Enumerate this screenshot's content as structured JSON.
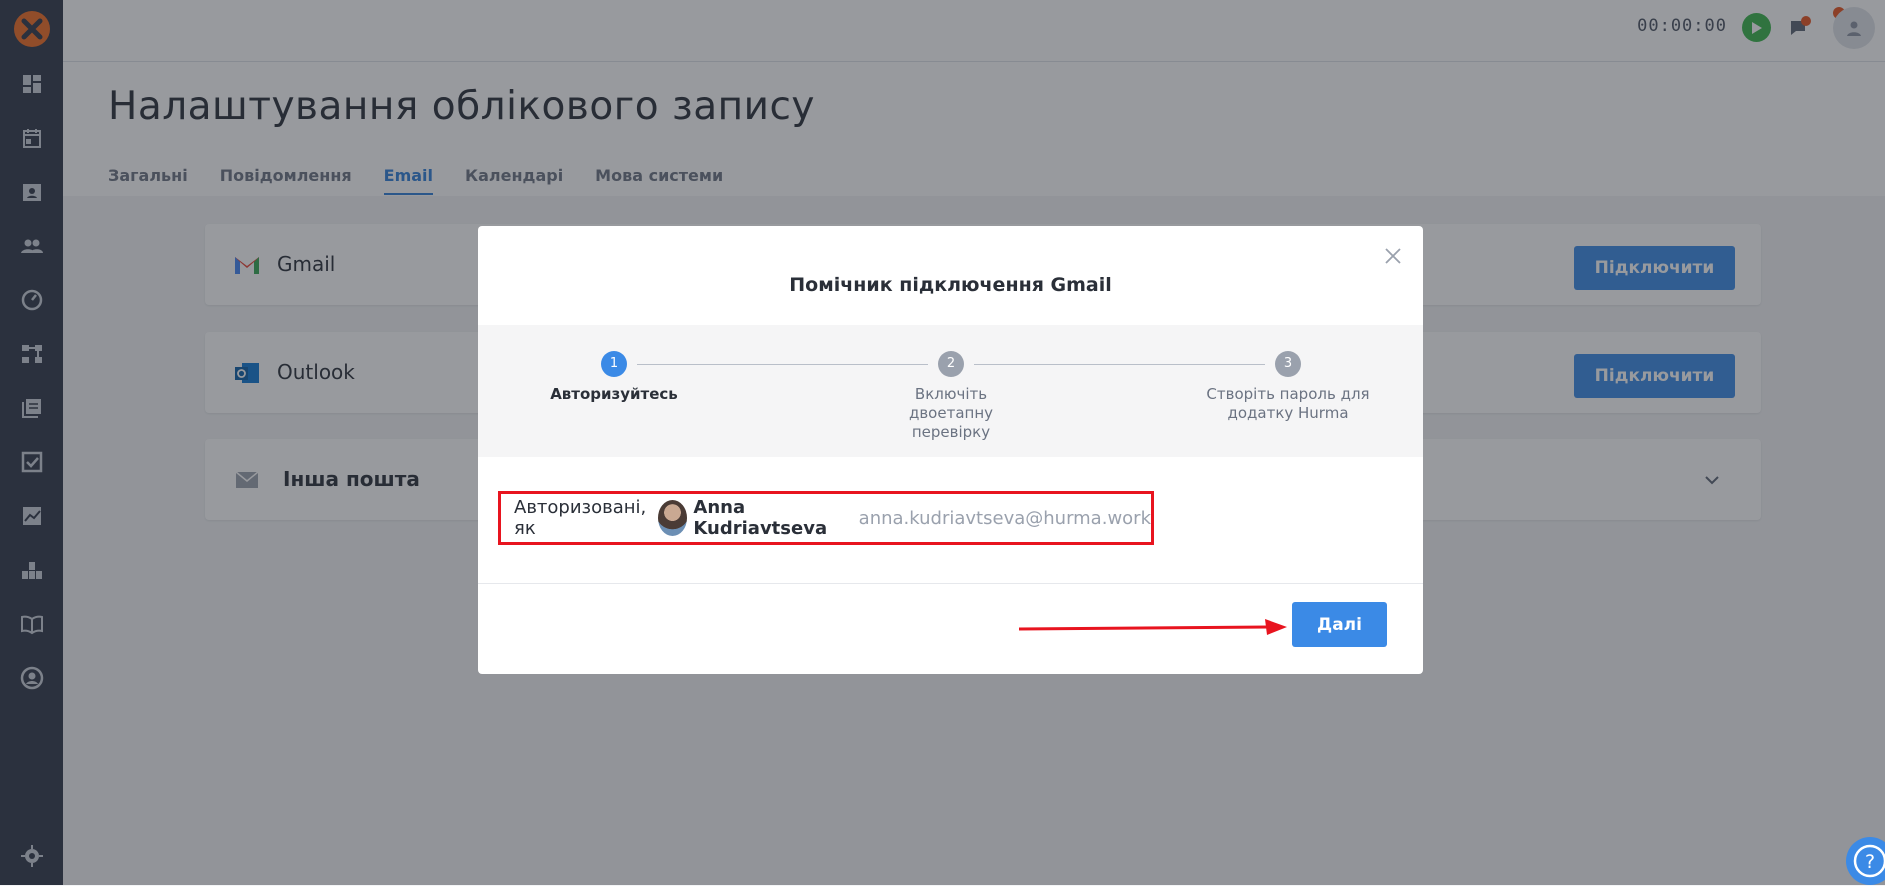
{
  "topbar": {
    "timer": "00:00:00"
  },
  "page": {
    "title": "Налаштування облікового запису",
    "tabs": [
      {
        "label": "Загальні"
      },
      {
        "label": "Повідомлення"
      },
      {
        "label": "Email"
      },
      {
        "label": "Календарі"
      },
      {
        "label": "Мова системи"
      }
    ],
    "active_tab": "Email"
  },
  "cards": {
    "gmail": {
      "label": "Gmail",
      "button": "Підключити"
    },
    "outlook": {
      "label": "Outlook",
      "button": "Підключити"
    },
    "other": {
      "label": "Інша пошта"
    }
  },
  "modal": {
    "title": "Помічник підключення Gmail",
    "steps": [
      {
        "number": "1",
        "label": "Авторизуйтесь"
      },
      {
        "number": "2",
        "label": "Включіть двоетапну перевірку"
      },
      {
        "number": "3",
        "label": "Створіть пароль для додатку Hurma"
      }
    ],
    "auth": {
      "prefix": "Авторизовані, як",
      "name": "Anna Kudriavtseva",
      "email": "anna.kudriavtseva@hurma.work"
    },
    "next_button": "Далі"
  },
  "colors": {
    "accent": "#3b8ae6",
    "sidebar": "#2f3747",
    "logo": "#f26b21",
    "annotation": "#e8141f"
  },
  "icons": [
    "logo-icon",
    "dashboard-icon",
    "calendar-icon",
    "contacts-icon",
    "people-icon",
    "speedometer-icon",
    "hierarchy-icon",
    "library-icon",
    "checklist-icon",
    "chart-icon",
    "blocks-icon",
    "book-icon",
    "user-circle-icon",
    "gear-icon"
  ]
}
